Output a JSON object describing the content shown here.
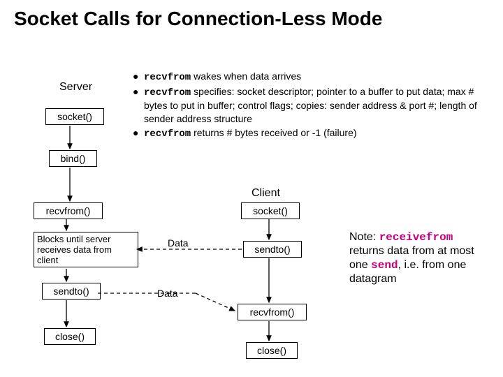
{
  "title": "Socket Calls for Connection-Less Mode",
  "bullets": {
    "b1a": "recvfrom",
    "b1b": " wakes when data arrives",
    "b2a": "recvfrom",
    "b2b": " specifies: socket descriptor; pointer to a buffer to put data; max # bytes to put in buffer; control flags; copies:  sender address & port #; length of sender address structure",
    "b3a": "recvfrom",
    "b3b": " returns # bytes received or -1 (failure)"
  },
  "labels": {
    "server": "Server",
    "client": "Client",
    "data1": "Data",
    "data2": "Data"
  },
  "server_boxes": {
    "socket": "socket()",
    "bind": "bind()",
    "recvfrom": "recvfrom()",
    "blocks": "Blocks until server receives data from client",
    "sendto": "sendto()",
    "close": "close()"
  },
  "client_boxes": {
    "socket": "socket()",
    "sendto": "sendto()",
    "recvfrom": "recvfrom()",
    "close": "close()"
  },
  "note": {
    "pre": "Note: ",
    "code1": "receivefrom",
    "mid1": " returns data from at most one ",
    "code2": "send",
    "mid2": ", i.e. from one datagram"
  }
}
